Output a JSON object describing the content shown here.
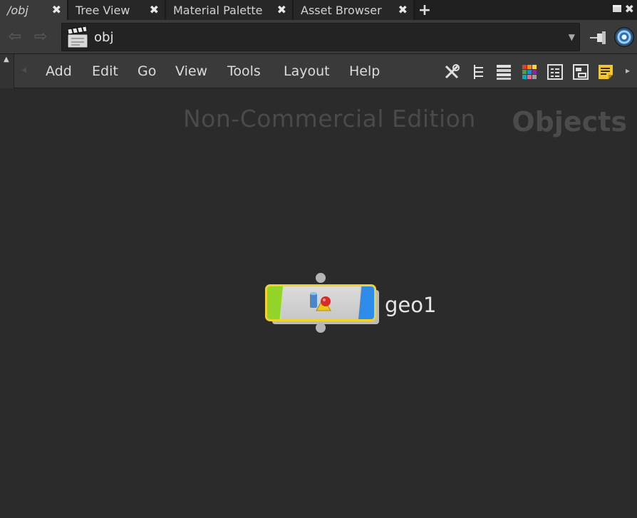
{
  "tabs": [
    {
      "label": "/obj",
      "active": true
    },
    {
      "label": "Tree View",
      "active": false
    },
    {
      "label": "Material Palette",
      "active": false
    },
    {
      "label": "Asset Browser",
      "active": false
    }
  ],
  "tab_close_glyph": "✖",
  "tab_add_glyph": "+",
  "path": {
    "icon": "network-clapper-icon",
    "value": "obj",
    "dropdown_glyph": "▼"
  },
  "nav": {
    "back_glyph": "⇦",
    "forward_glyph": "⇨"
  },
  "menu": {
    "items": [
      "Add",
      "Edit",
      "Go",
      "View",
      "Tools",
      "Layout",
      "Help"
    ]
  },
  "toolbar_icons": [
    "tools-icon",
    "tree-icon",
    "list-icon",
    "color-palette-icon",
    "parameters-icon",
    "network-box-icon",
    "sticky-note-icon"
  ],
  "canvas": {
    "watermark": "Non-Commercial Edition",
    "context": "Objects"
  },
  "node": {
    "name": "geo1",
    "type_icon": "geometry-icon",
    "colors": {
      "border": "#f2d22a",
      "display_flag": "#2f8bea",
      "template_flag": "#94d52a"
    }
  },
  "colors": {
    "canvas_bg": "#2b2b2b",
    "toolbar_bg": "#3a3a3a",
    "tab_bg": "#272727"
  }
}
